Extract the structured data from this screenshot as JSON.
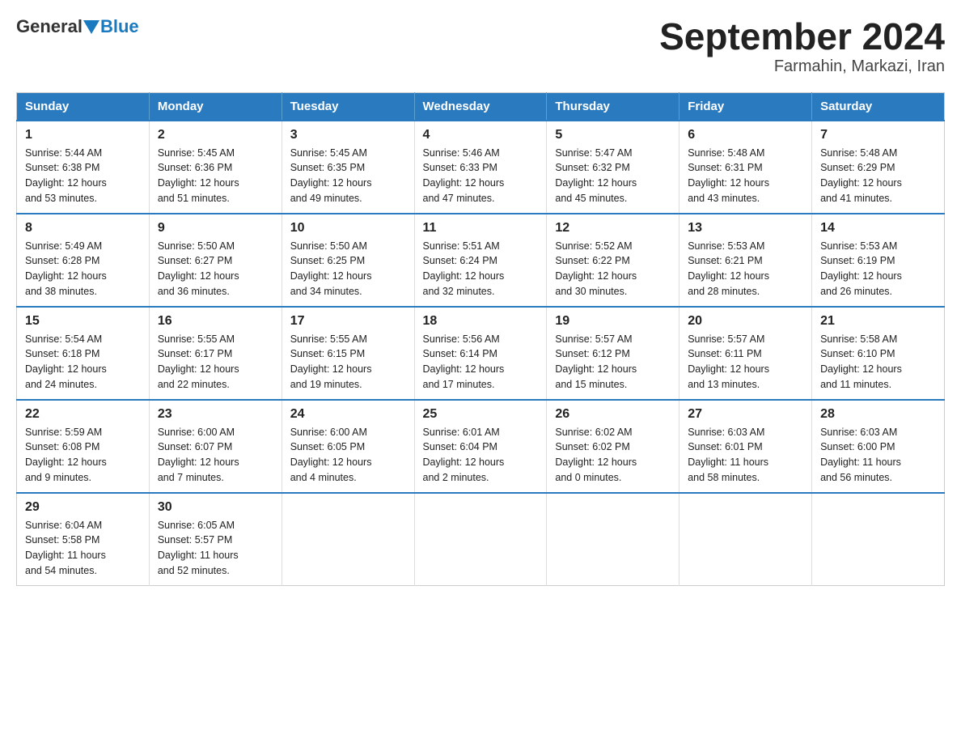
{
  "logo": {
    "general": "General",
    "blue": "Blue"
  },
  "title": "September 2024",
  "subtitle": "Farmahin, Markazi, Iran",
  "days_of_week": [
    "Sunday",
    "Monday",
    "Tuesday",
    "Wednesday",
    "Thursday",
    "Friday",
    "Saturday"
  ],
  "weeks": [
    [
      {
        "day": "1",
        "info": "Sunrise: 5:44 AM\nSunset: 6:38 PM\nDaylight: 12 hours\nand 53 minutes."
      },
      {
        "day": "2",
        "info": "Sunrise: 5:45 AM\nSunset: 6:36 PM\nDaylight: 12 hours\nand 51 minutes."
      },
      {
        "day": "3",
        "info": "Sunrise: 5:45 AM\nSunset: 6:35 PM\nDaylight: 12 hours\nand 49 minutes."
      },
      {
        "day": "4",
        "info": "Sunrise: 5:46 AM\nSunset: 6:33 PM\nDaylight: 12 hours\nand 47 minutes."
      },
      {
        "day": "5",
        "info": "Sunrise: 5:47 AM\nSunset: 6:32 PM\nDaylight: 12 hours\nand 45 minutes."
      },
      {
        "day": "6",
        "info": "Sunrise: 5:48 AM\nSunset: 6:31 PM\nDaylight: 12 hours\nand 43 minutes."
      },
      {
        "day": "7",
        "info": "Sunrise: 5:48 AM\nSunset: 6:29 PM\nDaylight: 12 hours\nand 41 minutes."
      }
    ],
    [
      {
        "day": "8",
        "info": "Sunrise: 5:49 AM\nSunset: 6:28 PM\nDaylight: 12 hours\nand 38 minutes."
      },
      {
        "day": "9",
        "info": "Sunrise: 5:50 AM\nSunset: 6:27 PM\nDaylight: 12 hours\nand 36 minutes."
      },
      {
        "day": "10",
        "info": "Sunrise: 5:50 AM\nSunset: 6:25 PM\nDaylight: 12 hours\nand 34 minutes."
      },
      {
        "day": "11",
        "info": "Sunrise: 5:51 AM\nSunset: 6:24 PM\nDaylight: 12 hours\nand 32 minutes."
      },
      {
        "day": "12",
        "info": "Sunrise: 5:52 AM\nSunset: 6:22 PM\nDaylight: 12 hours\nand 30 minutes."
      },
      {
        "day": "13",
        "info": "Sunrise: 5:53 AM\nSunset: 6:21 PM\nDaylight: 12 hours\nand 28 minutes."
      },
      {
        "day": "14",
        "info": "Sunrise: 5:53 AM\nSunset: 6:19 PM\nDaylight: 12 hours\nand 26 minutes."
      }
    ],
    [
      {
        "day": "15",
        "info": "Sunrise: 5:54 AM\nSunset: 6:18 PM\nDaylight: 12 hours\nand 24 minutes."
      },
      {
        "day": "16",
        "info": "Sunrise: 5:55 AM\nSunset: 6:17 PM\nDaylight: 12 hours\nand 22 minutes."
      },
      {
        "day": "17",
        "info": "Sunrise: 5:55 AM\nSunset: 6:15 PM\nDaylight: 12 hours\nand 19 minutes."
      },
      {
        "day": "18",
        "info": "Sunrise: 5:56 AM\nSunset: 6:14 PM\nDaylight: 12 hours\nand 17 minutes."
      },
      {
        "day": "19",
        "info": "Sunrise: 5:57 AM\nSunset: 6:12 PM\nDaylight: 12 hours\nand 15 minutes."
      },
      {
        "day": "20",
        "info": "Sunrise: 5:57 AM\nSunset: 6:11 PM\nDaylight: 12 hours\nand 13 minutes."
      },
      {
        "day": "21",
        "info": "Sunrise: 5:58 AM\nSunset: 6:10 PM\nDaylight: 12 hours\nand 11 minutes."
      }
    ],
    [
      {
        "day": "22",
        "info": "Sunrise: 5:59 AM\nSunset: 6:08 PM\nDaylight: 12 hours\nand 9 minutes."
      },
      {
        "day": "23",
        "info": "Sunrise: 6:00 AM\nSunset: 6:07 PM\nDaylight: 12 hours\nand 7 minutes."
      },
      {
        "day": "24",
        "info": "Sunrise: 6:00 AM\nSunset: 6:05 PM\nDaylight: 12 hours\nand 4 minutes."
      },
      {
        "day": "25",
        "info": "Sunrise: 6:01 AM\nSunset: 6:04 PM\nDaylight: 12 hours\nand 2 minutes."
      },
      {
        "day": "26",
        "info": "Sunrise: 6:02 AM\nSunset: 6:02 PM\nDaylight: 12 hours\nand 0 minutes."
      },
      {
        "day": "27",
        "info": "Sunrise: 6:03 AM\nSunset: 6:01 PM\nDaylight: 11 hours\nand 58 minutes."
      },
      {
        "day": "28",
        "info": "Sunrise: 6:03 AM\nSunset: 6:00 PM\nDaylight: 11 hours\nand 56 minutes."
      }
    ],
    [
      {
        "day": "29",
        "info": "Sunrise: 6:04 AM\nSunset: 5:58 PM\nDaylight: 11 hours\nand 54 minutes."
      },
      {
        "day": "30",
        "info": "Sunrise: 6:05 AM\nSunset: 5:57 PM\nDaylight: 11 hours\nand 52 minutes."
      },
      {
        "day": "",
        "info": ""
      },
      {
        "day": "",
        "info": ""
      },
      {
        "day": "",
        "info": ""
      },
      {
        "day": "",
        "info": ""
      },
      {
        "day": "",
        "info": ""
      }
    ]
  ]
}
